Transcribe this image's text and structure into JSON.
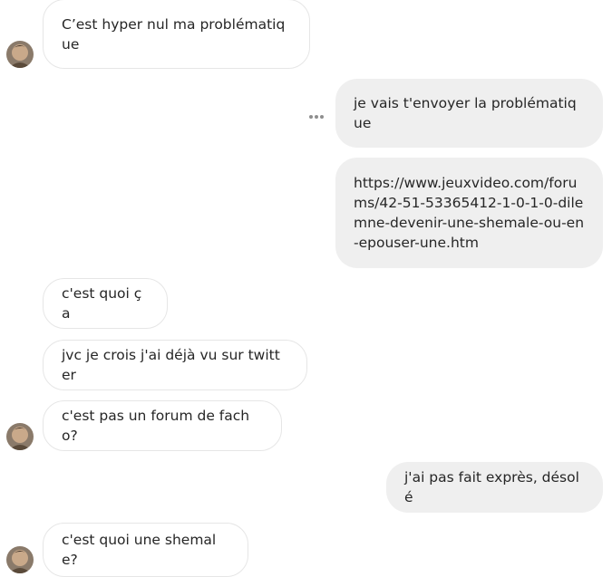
{
  "messages": [
    {
      "id": "m1",
      "direction": "incoming",
      "text": "C’est hyper nul ma problématique"
    },
    {
      "id": "m2",
      "direction": "outgoing",
      "text": "je vais t'envoyer la problématique"
    },
    {
      "id": "m3",
      "direction": "outgoing",
      "text": "https://www.jeuxvideo.com/forums/42-51-53365412-1-0-1-0-dilemne-devenir-une-shemale-ou-en-epouser-une.htm"
    },
    {
      "id": "m4",
      "direction": "incoming",
      "text": "c'est quoi ça"
    },
    {
      "id": "m5",
      "direction": "incoming",
      "text": "jvc je crois j'ai déjà vu sur twitter"
    },
    {
      "id": "m6",
      "direction": "incoming",
      "text": "c'est pas un forum de facho?"
    },
    {
      "id": "m7",
      "direction": "outgoing",
      "text": "j'ai pas fait exprès, désolé"
    },
    {
      "id": "m8",
      "direction": "incoming",
      "text": "c'est quoi une shemale?"
    }
  ],
  "colors": {
    "outgoing_bg": "#efefef",
    "incoming_border": "#e6e6e6",
    "text": "#262626"
  },
  "icons": {
    "avatar": "contact-avatar",
    "more": "more-options-icon"
  }
}
